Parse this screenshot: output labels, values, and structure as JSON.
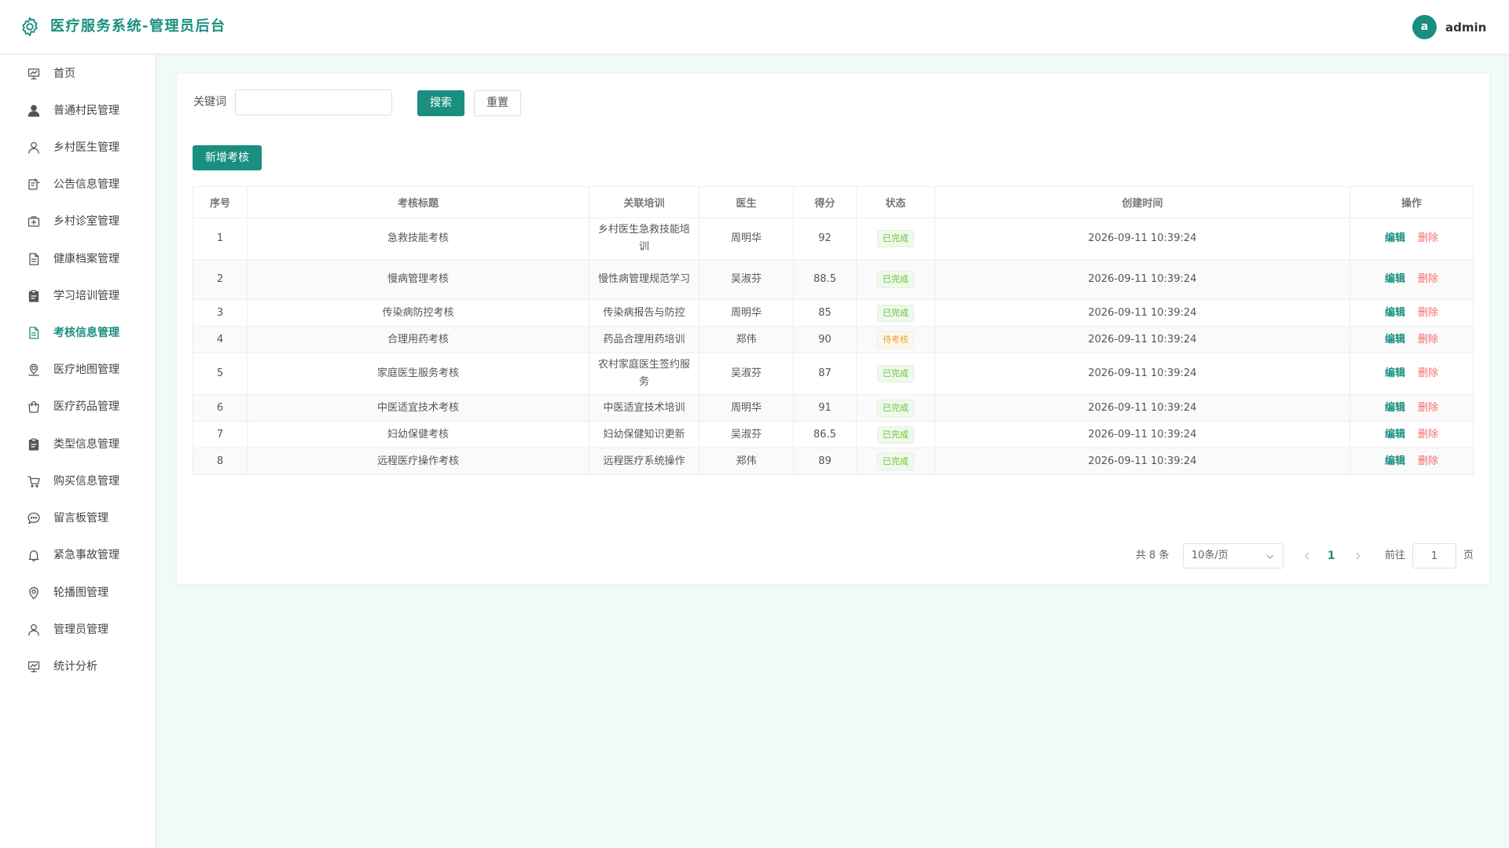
{
  "header": {
    "title": "医疗服务系统-管理员后台",
    "avatar_letter": "a",
    "username": "admin"
  },
  "sidebar": {
    "items": [
      {
        "label": "首页",
        "icon": "chart-board-icon"
      },
      {
        "label": "普通村民管理",
        "icon": "user-filled-icon"
      },
      {
        "label": "乡村医生管理",
        "icon": "user-icon"
      },
      {
        "label": "公告信息管理",
        "icon": "notice-icon"
      },
      {
        "label": "乡村诊室管理",
        "icon": "first-aid-kit-icon"
      },
      {
        "label": "健康档案管理",
        "icon": "document-icon"
      },
      {
        "label": "学习培训管理",
        "icon": "clipboard-icon"
      },
      {
        "label": "考核信息管理",
        "icon": "document-icon"
      },
      {
        "label": "医疗地图管理",
        "icon": "map-location-icon"
      },
      {
        "label": "医疗药品管理",
        "icon": "shopping-bag-icon"
      },
      {
        "label": "类型信息管理",
        "icon": "clipboard-icon"
      },
      {
        "label": "购买信息管理",
        "icon": "shopping-cart-icon"
      },
      {
        "label": "留言板管理",
        "icon": "chat-dot-icon"
      },
      {
        "label": "紧急事故管理",
        "icon": "bell-icon"
      },
      {
        "label": "轮播图管理",
        "icon": "location-pin-icon"
      },
      {
        "label": "管理员管理",
        "icon": "user-icon"
      },
      {
        "label": "统计分析",
        "icon": "chart-board-icon"
      }
    ],
    "active_index": 7
  },
  "search": {
    "label": "关键词",
    "value": "",
    "placeholder": "",
    "search_button": "搜索",
    "reset_button": "重置"
  },
  "toolbar": {
    "add_button": "新增考核"
  },
  "table": {
    "columns": [
      "序号",
      "考核标题",
      "关联培训",
      "医生",
      "得分",
      "状态",
      "创建时间",
      "操作"
    ],
    "rows": [
      {
        "no": "1",
        "title": "急救技能考核",
        "training": "乡村医生急救技能培训",
        "doctor": "周明华",
        "score": "92",
        "status": "已完成",
        "created": "2026-09-11 10:39:24"
      },
      {
        "no": "2",
        "title": "慢病管理考核",
        "training": "慢性病管理规范学习",
        "doctor": "吴淑芬",
        "score": "88.5",
        "status": "已完成",
        "created": "2026-09-11 10:39:24"
      },
      {
        "no": "3",
        "title": "传染病防控考核",
        "training": "传染病报告与防控",
        "doctor": "周明华",
        "score": "85",
        "status": "已完成",
        "created": "2026-09-11 10:39:24"
      },
      {
        "no": "4",
        "title": "合理用药考核",
        "training": "药品合理用药培训",
        "doctor": "郑伟",
        "score": "90",
        "status": "待考核",
        "created": "2026-09-11 10:39:24"
      },
      {
        "no": "5",
        "title": "家庭医生服务考核",
        "training": "农村家庭医生签约服务",
        "doctor": "吴淑芬",
        "score": "87",
        "status": "已完成",
        "created": "2026-09-11 10:39:24"
      },
      {
        "no": "6",
        "title": "中医适宜技术考核",
        "training": "中医适宜技术培训",
        "doctor": "周明华",
        "score": "91",
        "status": "已完成",
        "created": "2026-09-11 10:39:24"
      },
      {
        "no": "7",
        "title": "妇幼保健考核",
        "training": "妇幼保健知识更新",
        "doctor": "吴淑芬",
        "score": "86.5",
        "status": "已完成",
        "created": "2026-09-11 10:39:24"
      },
      {
        "no": "8",
        "title": "远程医疗操作考核",
        "training": "远程医疗系统操作",
        "doctor": "郑伟",
        "score": "89",
        "status": "已完成",
        "created": "2026-09-11 10:39:24"
      }
    ],
    "edit_label": "编辑",
    "delete_label": "删除"
  },
  "pagination": {
    "total_text": "共 8 条",
    "page_size": "10条/页",
    "current_page": "1",
    "goto_label": "前往",
    "goto_value": "1",
    "page_suffix": "页"
  },
  "colors": {
    "primary": "#1a8f80",
    "danger": "#f56c6c",
    "success": "#67c23a",
    "warning": "#e6a23c",
    "background": "#f0faf8"
  }
}
